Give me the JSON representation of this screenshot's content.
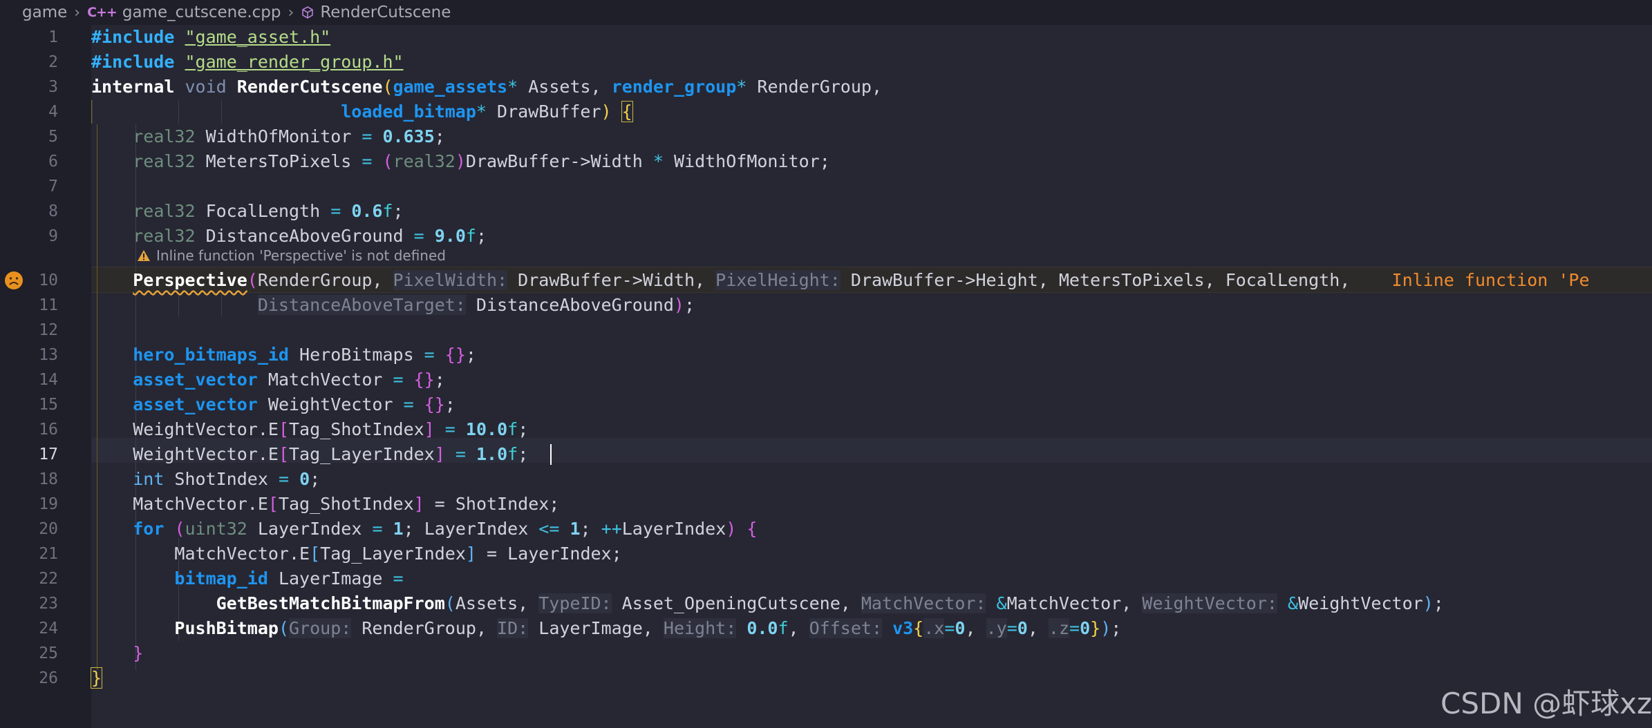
{
  "breadcrumb": {
    "folder": "game",
    "file_icon_text": "C++",
    "file": "game_cutscene.cpp",
    "symbol": "RenderCutscene"
  },
  "warning": {
    "text": "Inline function 'Perspective' is not defined",
    "inline_text": "Inline function 'Pe"
  },
  "active_line": 17,
  "line_numbers": [
    "1",
    "2",
    "3",
    "4",
    "5",
    "6",
    "7",
    "8",
    "9",
    "10",
    "11",
    "12",
    "13",
    "14",
    "15",
    "16",
    "17",
    "18",
    "19",
    "20",
    "21",
    "22",
    "23",
    "24",
    "25",
    "26"
  ],
  "code": {
    "l1_a": "#include",
    "l1_b": "\"game_asset.h\"",
    "l2_a": "#include",
    "l2_b": "\"game_render_group.h\"",
    "l3_a": "internal",
    "l3_b": "void",
    "l3_c": "RenderCutscene",
    "l3_d": "(",
    "l3_e": "game_assets",
    "l3_f": "*",
    "l3_g": " Assets, ",
    "l3_h": "render_group",
    "l3_i": "*",
    "l3_j": " RenderGroup,",
    "l4_a": "loaded_bitmap",
    "l4_b": "*",
    "l4_c": " DrawBuffer",
    "l4_d": ")",
    "l4_e": "{",
    "l5_a": "real32",
    "l5_b": " WidthOfMonitor ",
    "l5_c": "=",
    "l5_d": "0.635",
    "l5_e": ";",
    "l6_a": "real32",
    "l6_b": " MetersToPixels ",
    "l6_c": "=",
    "l6_d": "(",
    "l6_e": "real32",
    "l6_f": ")",
    "l6_g": "DrawBuffer->Width ",
    "l6_h": "*",
    "l6_i": " WidthOfMonitor;",
    "l8_a": "real32",
    "l8_b": " FocalLength ",
    "l8_c": "=",
    "l8_d": "0.6",
    "l8_e": "f",
    "l8_f": ";",
    "l9_a": "real32",
    "l9_b": " DistanceAboveGround ",
    "l9_c": "=",
    "l9_d": "9.0",
    "l9_e": "f",
    "l9_f": ";",
    "l10_a": "Perspective",
    "l10_b": "(",
    "l10_c": "RenderGroup, ",
    "l10_d": "PixelWidth:",
    "l10_e": "DrawBuffer->Width, ",
    "l10_f": "PixelHeight:",
    "l10_g": "DrawBuffer->Height, MetersToPixels, FocalLength,",
    "l11_a": "DistanceAboveTarget:",
    "l11_b": "DistanceAboveGround",
    "l11_c": ")",
    "l11_d": ";",
    "l13_a": "hero_bitmaps_id",
    "l13_b": " HeroBitmaps ",
    "l13_c": "=",
    "l13_d": "{}",
    "l13_e": ";",
    "l14_a": "asset_vector",
    "l14_b": " MatchVector ",
    "l14_c": "=",
    "l14_d": "{}",
    "l14_e": ";",
    "l15_a": "asset_vector",
    "l15_b": " WeightVector ",
    "l15_c": "=",
    "l15_d": "{}",
    "l15_e": ";",
    "l16_a": "WeightVector.E",
    "l16_b": "[",
    "l16_c": "Tag_ShotIndex",
    "l16_d": "]",
    "l16_e": "=",
    "l16_f": "10.0",
    "l16_g": "f",
    "l16_h": ";",
    "l17_a": "WeightVector.E",
    "l17_b": "[",
    "l17_c": "Tag_LayerIndex",
    "l17_d": "]",
    "l17_e": "=",
    "l17_f": "1.0",
    "l17_g": "f",
    "l17_h": ";",
    "l18_a": "int",
    "l18_b": " ShotIndex ",
    "l18_c": "=",
    "l18_d": "0",
    "l18_e": ";",
    "l19_a": "MatchVector.E",
    "l19_b": "[",
    "l19_c": "Tag_ShotIndex",
    "l19_d": "]",
    "l19_e": " = ShotIndex;",
    "l20_a": "for",
    "l20_b": "(",
    "l20_c": "uint32",
    "l20_d": " LayerIndex ",
    "l20_e": "=",
    "l20_f": "1",
    "l20_g": "; LayerIndex ",
    "l20_h": "<=",
    "l20_i": "1",
    "l20_j": "; ",
    "l20_k": "++",
    "l20_l": "LayerIndex",
    "l20_m": ")",
    "l20_n": "{",
    "l21_a": "MatchVector.E",
    "l21_b": "[",
    "l21_c": "Tag_LayerIndex",
    "l21_d": "]",
    "l21_e": " = LayerIndex;",
    "l22_a": "bitmap_id",
    "l22_b": " LayerImage ",
    "l22_c": "=",
    "l23_a": "GetBestMatchBitmapFrom",
    "l23_b": "(",
    "l23_c": "Assets, ",
    "l23_d": "TypeID:",
    "l23_e": "Asset_OpeningCutscene, ",
    "l23_f": "MatchVector:",
    "l23_g": "&",
    "l23_h": "MatchVector, ",
    "l23_i": "WeightVector:",
    "l23_j": "&",
    "l23_k": "WeightVector",
    "l23_l": ")",
    "l23_m": ";",
    "l24_a": "PushBitmap",
    "l24_b": "(",
    "l24_c": "Group:",
    "l24_d": "RenderGroup, ",
    "l24_e": "ID:",
    "l24_f": "LayerImage, ",
    "l24_g": "Height:",
    "l24_h": "0.0",
    "l24_i": "f",
    "l24_j": ", ",
    "l24_k": "Offset:",
    "l24_l": "v3",
    "l24_m": "{",
    "l24_n": ".x",
    "l24_o": "=",
    "l24_p": "0",
    "l24_q": ", ",
    "l24_r": ".y",
    "l24_s": "=",
    "l24_t": "0",
    "l24_u": ", ",
    "l24_v": ".z",
    "l24_w": "=",
    "l24_x": "0",
    "l24_y": "}",
    "l24_z": ")",
    "l24_zz": ";",
    "l25_a": "}",
    "l26_a": "}"
  },
  "watermark": "CSDN @虾球xz",
  "colors": {
    "background": "#262733",
    "gutter": "#1e1f28",
    "keyword": "#1e95f0",
    "warning": "#f08c2e",
    "bracket_gold": "#f6d04d",
    "bracket_purple": "#d55fde"
  }
}
